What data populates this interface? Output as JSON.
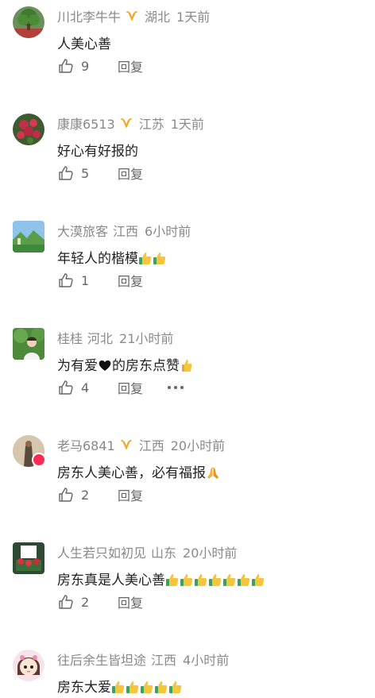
{
  "comments": [
    {
      "name": "川北李牛牛",
      "verified": true,
      "location": "湖北",
      "time": "1天前",
      "text": "人美心善",
      "emojis": [],
      "likes": "9",
      "reply": "回复",
      "more": false
    },
    {
      "name": "康康6513",
      "verified": true,
      "location": "江苏",
      "time": "1天前",
      "text": "好心有好报的",
      "emojis": [],
      "likes": "5",
      "reply": "回复",
      "more": false
    },
    {
      "name": "大漠旅客",
      "verified": false,
      "location": "江西",
      "time": "6小时前",
      "text": "年轻人的楷模",
      "emojis": [
        "thumbs-up-icon",
        "thumbs-up-icon"
      ],
      "likes": "1",
      "reply": "回复",
      "more": false
    },
    {
      "name": "桂桂",
      "verified": false,
      "location": "河北",
      "time": "21小时前",
      "text_before": "为有爱",
      "text_after": "的房东点赞",
      "emojis": [
        "thumbs-up-icon"
      ],
      "likes": "4",
      "reply": "回复",
      "more": true
    },
    {
      "name": "老马6841",
      "verified": true,
      "location": "江西",
      "time": "20小时前",
      "text": "房东人美心善，必有福报",
      "emojis": [
        "praying-hands-icon"
      ],
      "likes": "2",
      "reply": "回复",
      "more": false
    },
    {
      "name": "人生若只如初见",
      "verified": false,
      "location": "山东",
      "time": "20小时前",
      "text": "房东真是人美心善",
      "emojis": [
        "thumbs-up-icon",
        "thumbs-up-icon",
        "thumbs-up-icon",
        "thumbs-up-icon",
        "thumbs-up-icon",
        "thumbs-up-icon",
        "thumbs-up-icon"
      ],
      "likes": "2",
      "reply": "回复",
      "more": false
    },
    {
      "name": "往后余生皆坦途",
      "verified": false,
      "location": "江西",
      "time": "4小时前",
      "text": "房东大爱",
      "emojis": [
        "thumbs-up-icon",
        "thumbs-up-icon",
        "thumbs-up-icon",
        "thumbs-up-icon",
        "thumbs-up-icon"
      ],
      "likes": "",
      "reply": "",
      "more": false
    }
  ],
  "colors": {
    "name": "#888888",
    "text": "#222222",
    "action": "#666666",
    "verified_badge": "#f5a623"
  }
}
